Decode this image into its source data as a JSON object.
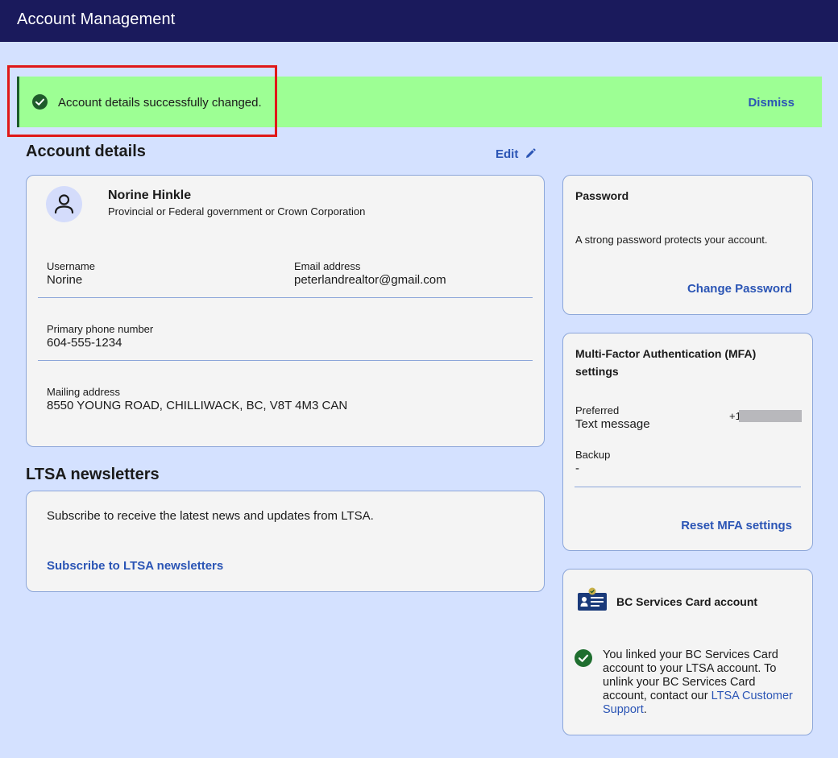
{
  "header": {
    "title": "Account Management"
  },
  "banner": {
    "message": "Account details successfully changed.",
    "dismiss_label": "Dismiss"
  },
  "account_details": {
    "heading": "Account details",
    "edit_label": "Edit",
    "name": "Norine Hinkle",
    "organization": "Provincial or Federal government or Crown Corporation",
    "username_label": "Username",
    "username": "Norine",
    "email_label": "Email address",
    "email": "peterlandrealtor@gmail.com",
    "phone_label": "Primary phone number",
    "phone": "604-555-1234",
    "mailing_label": "Mailing address",
    "mailing": "8550 YOUNG ROAD, CHILLIWACK, BC, V8T 4M3 CAN"
  },
  "newsletters": {
    "heading": "LTSA newsletters",
    "description": "Subscribe to receive the latest news and updates from LTSA.",
    "subscribe_label": "Subscribe to LTSA newsletters"
  },
  "password": {
    "title": "Password",
    "description": "A strong password protects your account.",
    "action_label": "Change Password"
  },
  "mfa": {
    "title_line1": "Multi-Factor Authentication (MFA)",
    "title_line2": "settings",
    "preferred_label": "Preferred",
    "preferred_value": "Text message",
    "phone_prefix": "+1",
    "backup_label": "Backup",
    "backup_value": "-",
    "action_label": "Reset MFA settings"
  },
  "bc_services": {
    "title": "BC Services Card account",
    "linked_text": "You linked your BC Services Card account to your LTSA account. To unlink your BC Services Card account, contact our",
    "support_link": "LTSA Customer Support",
    "trailing": "."
  },
  "colors": {
    "header_bg": "#1a1a5c",
    "page_bg": "#d4e1ff",
    "banner_bg": "#9dff94",
    "link": "#2b55b5",
    "success": "#1f5a2b",
    "highlight": "#e01818"
  }
}
